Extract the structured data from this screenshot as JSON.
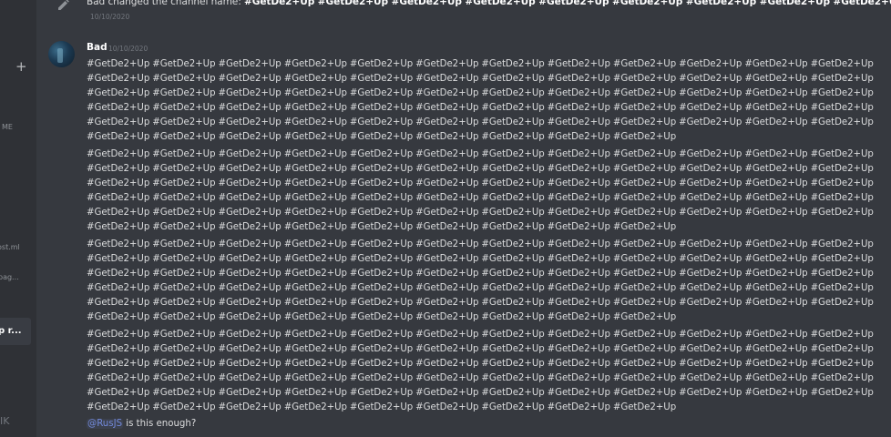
{
  "sidebar": {
    "plus": "+",
    "me_label": "ME",
    "item_ml": "ost.ml",
    "item_pag": "pag...",
    "active_item": "p r...",
    "bottom_label": "IK"
  },
  "system_message": {
    "text_prefix": "Bad changed the channel name: ",
    "channel_name": "#GetDe2+Up #GetDe2+Up #GetDe2+Up #GetDe2+Up #GetDe2+Up #GetDe2+Up #GetDe2+Up #GetDe2+Up #GetDe2+Up #",
    "timestamp": "10/10/2020"
  },
  "message": {
    "username": "Bad",
    "timestamp": "10/10/2020",
    "paragraphs": [
      "#GetDe2+Up #GetDe2+Up #GetDe2+Up #GetDe2+Up #GetDe2+Up #GetDe2+Up #GetDe2+Up #GetDe2+Up #GetDe2+Up #GetDe2+Up #GetDe2+Up #GetDe2+Up #GetDe2+Up #GetDe2+Up #GetDe2+Up #GetDe2+Up #GetDe2+Up #GetDe2+Up #GetDe2+Up #GetDe2+Up #GetDe2+Up #GetDe2+Up #GetDe2+Up #GetDe2+Up #GetDe2+Up #GetDe2+Up #GetDe2+Up #GetDe2+Up #GetDe2+Up #GetDe2+Up #GetDe2+Up #GetDe2+Up #GetDe2+Up #GetDe2+Up #GetDe2+Up #GetDe2+Up #GetDe2+Up #GetDe2+Up #GetDe2+Up #GetDe2+Up #GetDe2+Up #GetDe2+Up #GetDe2+Up #GetDe2+Up #GetDe2+Up #GetDe2+Up #GetDe2+Up #GetDe2+Up #GetDe2+Up #GetDe2+Up #GetDe2+Up #GetDe2+Up #GetDe2+Up #GetDe2+Up #GetDe2+Up #GetDe2+Up #GetDe2+Up #GetDe2+Up #GetDe2+Up #GetDe2+Up #GetDe2+Up #GetDe2+Up #GetDe2+Up #GetDe2+Up #GetDe2+Up #GetDe2+Up #GetDe2+Up #GetDe2+Up #GetDe2+Up",
      "#GetDe2+Up #GetDe2+Up #GetDe2+Up #GetDe2+Up #GetDe2+Up #GetDe2+Up #GetDe2+Up #GetDe2+Up #GetDe2+Up #GetDe2+Up #GetDe2+Up #GetDe2+Up #GetDe2+Up #GetDe2+Up #GetDe2+Up #GetDe2+Up #GetDe2+Up #GetDe2+Up #GetDe2+Up #GetDe2+Up #GetDe2+Up #GetDe2+Up #GetDe2+Up #GetDe2+Up #GetDe2+Up #GetDe2+Up #GetDe2+Up #GetDe2+Up #GetDe2+Up #GetDe2+Up #GetDe2+Up #GetDe2+Up #GetDe2+Up #GetDe2+Up #GetDe2+Up #GetDe2+Up #GetDe2+Up #GetDe2+Up #GetDe2+Up #GetDe2+Up #GetDe2+Up #GetDe2+Up #GetDe2+Up #GetDe2+Up #GetDe2+Up #GetDe2+Up #GetDe2+Up #GetDe2+Up #GetDe2+Up #GetDe2+Up #GetDe2+Up #GetDe2+Up #GetDe2+Up #GetDe2+Up #GetDe2+Up #GetDe2+Up #GetDe2+Up #GetDe2+Up #GetDe2+Up #GetDe2+Up #GetDe2+Up #GetDe2+Up #GetDe2+Up #GetDe2+Up #GetDe2+Up #GetDe2+Up #GetDe2+Up #GetDe2+Up #GetDe2+Up",
      "#GetDe2+Up #GetDe2+Up #GetDe2+Up #GetDe2+Up #GetDe2+Up #GetDe2+Up #GetDe2+Up #GetDe2+Up #GetDe2+Up #GetDe2+Up #GetDe2+Up #GetDe2+Up #GetDe2+Up #GetDe2+Up #GetDe2+Up #GetDe2+Up #GetDe2+Up #GetDe2+Up #GetDe2+Up #GetDe2+Up #GetDe2+Up #GetDe2+Up #GetDe2+Up #GetDe2+Up #GetDe2+Up #GetDe2+Up #GetDe2+Up #GetDe2+Up #GetDe2+Up #GetDe2+Up #GetDe2+Up #GetDe2+Up #GetDe2+Up #GetDe2+Up #GetDe2+Up #GetDe2+Up #GetDe2+Up #GetDe2+Up #GetDe2+Up #GetDe2+Up #GetDe2+Up #GetDe2+Up #GetDe2+Up #GetDe2+Up #GetDe2+Up #GetDe2+Up #GetDe2+Up #GetDe2+Up #GetDe2+Up #GetDe2+Up #GetDe2+Up #GetDe2+Up #GetDe2+Up #GetDe2+Up #GetDe2+Up #GetDe2+Up #GetDe2+Up #GetDe2+Up #GetDe2+Up #GetDe2+Up #GetDe2+Up #GetDe2+Up #GetDe2+Up #GetDe2+Up #GetDe2+Up #GetDe2+Up #GetDe2+Up #GetDe2+Up #GetDe2+Up",
      "#GetDe2+Up #GetDe2+Up #GetDe2+Up #GetDe2+Up #GetDe2+Up #GetDe2+Up #GetDe2+Up #GetDe2+Up #GetDe2+Up #GetDe2+Up #GetDe2+Up #GetDe2+Up #GetDe2+Up #GetDe2+Up #GetDe2+Up #GetDe2+Up #GetDe2+Up #GetDe2+Up #GetDe2+Up #GetDe2+Up #GetDe2+Up #GetDe2+Up #GetDe2+Up #GetDe2+Up #GetDe2+Up #GetDe2+Up #GetDe2+Up #GetDe2+Up #GetDe2+Up #GetDe2+Up #GetDe2+Up #GetDe2+Up #GetDe2+Up #GetDe2+Up #GetDe2+Up #GetDe2+Up #GetDe2+Up #GetDe2+Up #GetDe2+Up #GetDe2+Up #GetDe2+Up #GetDe2+Up #GetDe2+Up #GetDe2+Up #GetDe2+Up #GetDe2+Up #GetDe2+Up #GetDe2+Up #GetDe2+Up #GetDe2+Up #GetDe2+Up #GetDe2+Up #GetDe2+Up #GetDe2+Up #GetDe2+Up #GetDe2+Up #GetDe2+Up #GetDe2+Up #GetDe2+Up #GetDe2+Up #GetDe2+Up #GetDe2+Up #GetDe2+Up #GetDe2+Up #GetDe2+Up #GetDe2+Up #GetDe2+Up #GetDe2+Up #GetDe2+Up"
    ],
    "mention": "@RusJS",
    "final_text": " is this enough?"
  },
  "colors": {
    "background": "#36393f",
    "sidebar": "#2f3136",
    "text": "#dcddde",
    "muted": "#72767d",
    "mention": "#7289da"
  },
  "icons": {
    "system": "pencil-icon"
  }
}
